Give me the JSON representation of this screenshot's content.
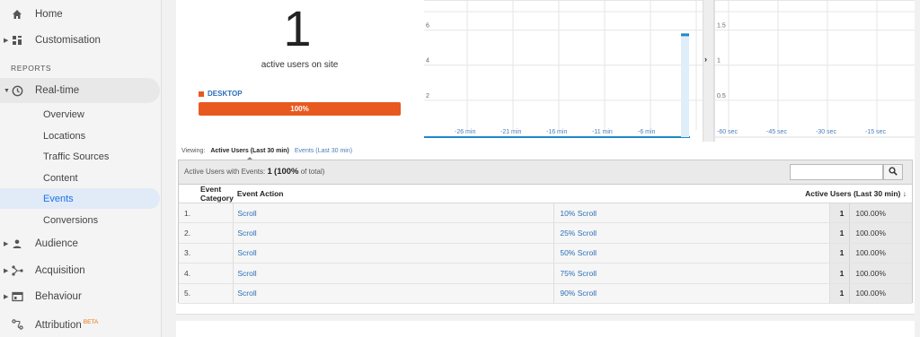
{
  "sidebar": {
    "home": "Home",
    "customisation": "Customisation",
    "section_reports": "REPORTS",
    "realtime": "Real-time",
    "realtime_sub": [
      "Overview",
      "Locations",
      "Traffic Sources",
      "Content",
      "Events",
      "Conversions"
    ],
    "active_sub": "Events",
    "audience": "Audience",
    "acquisition": "Acquisition",
    "behaviour": "Behaviour",
    "attribution": "Attribution",
    "attribution_badge": "BETA"
  },
  "overview": {
    "active_users": "1",
    "active_users_label": "active users on site",
    "device_label": "DESKTOP",
    "device_pct": "100%",
    "device_color": "#e8591f"
  },
  "chart_data": [
    {
      "type": "bar",
      "y_ticks": [
        "6",
        "4",
        "2"
      ],
      "x_ticks": [
        "-26 min",
        "-21 min",
        "-16 min",
        "-11 min",
        "-6 min",
        "-1"
      ],
      "ylim": [
        0,
        7
      ],
      "bars": [
        {
          "x": "-1",
          "value": 5.5
        }
      ],
      "bar_color": "#1e88c8"
    },
    {
      "type": "bar",
      "y_ticks": [
        "1.5",
        "1",
        "0.5"
      ],
      "x_ticks": [
        "-60 sec",
        "-45 sec",
        "-30 sec",
        "-15 sec"
      ],
      "ylim": [
        0,
        1.75
      ],
      "bars": []
    }
  ],
  "viewing": {
    "label": "Viewing:",
    "active_tab": "Active Users (Last 30 min)",
    "other_tab": "Events (Last 30 min)"
  },
  "table": {
    "summary_prefix": "Active Users with Events:",
    "summary_value": "1",
    "summary_pct": "100%",
    "summary_suffix": "of total)",
    "columns": [
      "Event Category",
      "Event Action",
      "Active Users (Last 30 min)"
    ],
    "rows": [
      {
        "idx": "1.",
        "category": "Scroll",
        "action": "10% Scroll",
        "users": "1",
        "pct": "100.00%"
      },
      {
        "idx": "2.",
        "category": "Scroll",
        "action": "25% Scroll",
        "users": "1",
        "pct": "100.00%"
      },
      {
        "idx": "3.",
        "category": "Scroll",
        "action": "50% Scroll",
        "users": "1",
        "pct": "100.00%"
      },
      {
        "idx": "4.",
        "category": "Scroll",
        "action": "75% Scroll",
        "users": "1",
        "pct": "100.00%"
      },
      {
        "idx": "5.",
        "category": "Scroll",
        "action": "90% Scroll",
        "users": "1",
        "pct": "100.00%"
      }
    ]
  },
  "icons": {
    "home": "home-icon",
    "customisation": "dashboard-icon",
    "realtime": "clock-icon",
    "audience": "person-icon",
    "acquisition": "acquisition-icon",
    "behaviour": "behaviour-icon",
    "attribution": "attribution-icon",
    "search": "search-icon"
  }
}
